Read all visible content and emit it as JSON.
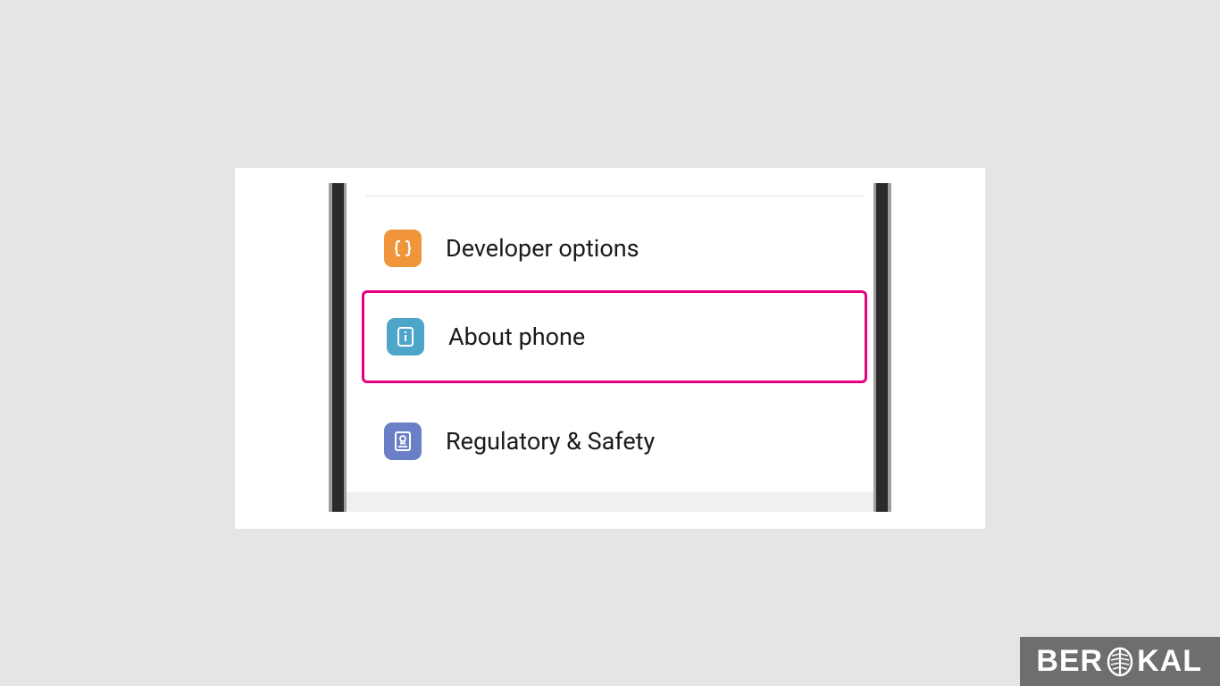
{
  "settings": {
    "items": [
      {
        "label": "Developer options",
        "icon": "braces-icon",
        "iconColor": "#f09539"
      },
      {
        "label": "About phone",
        "icon": "info-icon",
        "iconColor": "#4da6c9",
        "highlighted": true
      },
      {
        "label": "Regulatory & Safety",
        "icon": "certificate-icon",
        "iconColor": "#6b7fc7"
      }
    ]
  },
  "watermark": {
    "prefix": "BER",
    "suffix": "KAL"
  }
}
